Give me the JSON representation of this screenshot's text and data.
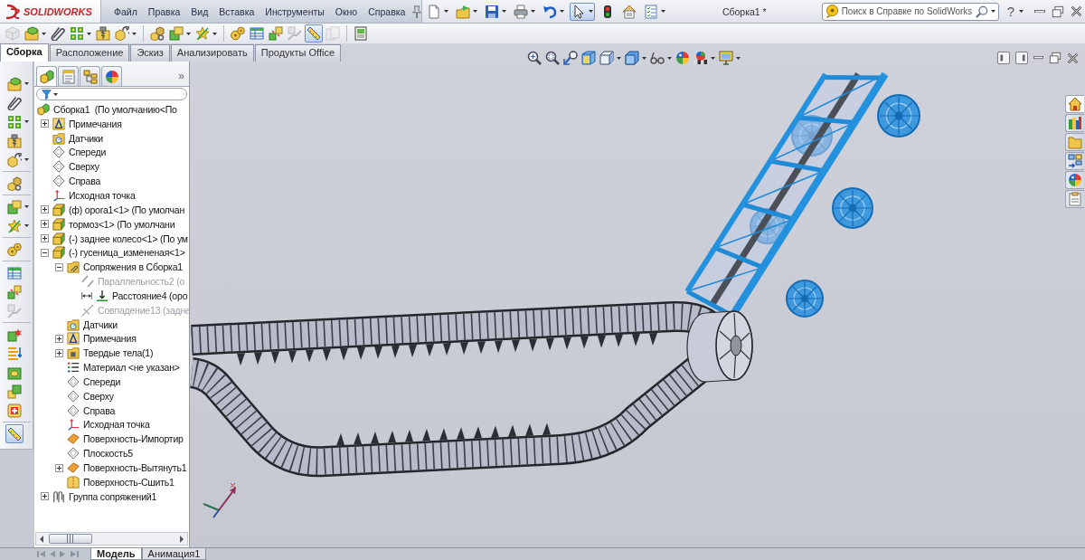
{
  "title_bar": {
    "logo": "SOLIDWORKS",
    "menu": [
      "Файл",
      "Правка",
      "Вид",
      "Вставка",
      "Инструменты",
      "Окно",
      "Справка"
    ],
    "quick_tools": [
      {
        "kind": "document",
        "dropdown": true,
        "selected": false
      },
      {
        "kind": "folder_arrow",
        "dropdown": true,
        "selected": false
      },
      {
        "kind": "floppy",
        "dropdown": true,
        "selected": false
      },
      {
        "kind": "printer",
        "dropdown": true,
        "selected": false
      },
      {
        "kind": "curved_arrow",
        "dropdown": true,
        "selected": false
      },
      {
        "kind": "cursor",
        "dropdown": true,
        "selected": true
      },
      {
        "kind": "traffic_light",
        "dropdown": false,
        "selected": false
      },
      {
        "kind": "house_page",
        "dropdown": false,
        "selected": false
      },
      {
        "kind": "checklist",
        "dropdown": true,
        "selected": false
      }
    ],
    "document_title": "Сборка1 *",
    "search": {
      "placeholder": "Поиск в Справке по SolidWorks"
    },
    "help": "?"
  },
  "command_toolbar": [
    {
      "kind": "cube",
      "dropdown": false,
      "disabled": true,
      "selected": false
    },
    {
      "kind": "folder_cube",
      "dropdown": true,
      "disabled": false,
      "selected": false
    },
    {
      "kind": "paperclip",
      "dropdown": false,
      "disabled": false,
      "selected": false
    },
    {
      "kind": "dot_grid",
      "dropdown": true,
      "disabled": false,
      "selected": false
    },
    {
      "kind": "screw",
      "dropdown": false,
      "disabled": false,
      "selected": false
    },
    {
      "kind": "cube_arrow",
      "dropdown": true,
      "disabled": false,
      "selected": false
    },
    {
      "kind": "separator"
    },
    {
      "kind": "cubes",
      "dropdown": false,
      "disabled": false,
      "selected": false
    },
    {
      "kind": "block",
      "dropdown": true,
      "disabled": false,
      "selected": false
    },
    {
      "kind": "axis_star",
      "dropdown": true,
      "disabled": false,
      "selected": false
    },
    {
      "kind": "separator"
    },
    {
      "kind": "gears",
      "dropdown": false,
      "disabled": false,
      "selected": false
    },
    {
      "kind": "table",
      "dropdown": false,
      "disabled": false,
      "selected": false
    },
    {
      "kind": "explode",
      "dropdown": false,
      "disabled": false,
      "selected": false
    },
    {
      "kind": "line_sketch",
      "dropdown": false,
      "disabled": true,
      "selected": false
    },
    {
      "kind": "ruler",
      "dropdown": false,
      "disabled": false,
      "selected": true
    },
    {
      "kind": "pages",
      "dropdown": false,
      "disabled": true,
      "selected": false
    },
    {
      "kind": "separator"
    },
    {
      "kind": "sheet",
      "dropdown": false,
      "disabled": false,
      "selected": false
    }
  ],
  "command_tabs": [
    {
      "label": "Сборка",
      "selected": true
    },
    {
      "label": "Расположение",
      "selected": false
    },
    {
      "label": "Эскиз",
      "selected": false
    },
    {
      "label": "Анализировать",
      "selected": false
    },
    {
      "label": "Продукты Office",
      "selected": false
    }
  ],
  "left_toolbar": [
    {
      "kind": "folder_cube",
      "dropdown": true,
      "disabled": false,
      "selected": false
    },
    {
      "kind": "paperclip",
      "dropdown": false,
      "disabled": false,
      "selected": false
    },
    {
      "kind": "dot_grid",
      "dropdown": true,
      "disabled": false,
      "selected": false
    },
    {
      "kind": "screw",
      "dropdown": false,
      "disabled": false,
      "selected": false
    },
    {
      "kind": "cube_arrow",
      "dropdown": true,
      "disabled": false,
      "selected": false
    },
    {
      "kind": "separator"
    },
    {
      "kind": "cubes",
      "dropdown": false,
      "disabled": false,
      "selected": false
    },
    {
      "kind": "separator"
    },
    {
      "kind": "block",
      "dropdown": true,
      "disabled": false,
      "selected": false
    },
    {
      "kind": "axis_star",
      "dropdown": true,
      "disabled": false,
      "selected": false
    },
    {
      "kind": "separator"
    },
    {
      "kind": "gears",
      "dropdown": false,
      "disabled": false,
      "selected": false
    },
    {
      "kind": "separator"
    },
    {
      "kind": "table",
      "dropdown": false,
      "disabled": false,
      "selected": false
    },
    {
      "kind": "explode",
      "dropdown": false,
      "disabled": false,
      "selected": false
    },
    {
      "kind": "line_sketch",
      "dropdown": false,
      "disabled": true,
      "selected": false
    },
    {
      "kind": "separator"
    },
    {
      "kind": "collision",
      "dropdown": false,
      "disabled": false,
      "selected": false
    },
    {
      "kind": "align",
      "dropdown": false,
      "disabled": false,
      "selected": false
    },
    {
      "kind": "hole",
      "dropdown": false,
      "disabled": false,
      "selected": false
    },
    {
      "kind": "blocks",
      "dropdown": false,
      "disabled": false,
      "selected": false
    },
    {
      "kind": "plus_box",
      "dropdown": false,
      "disabled": false,
      "selected": false
    },
    {
      "kind": "separator"
    },
    {
      "kind": "ruler",
      "dropdown": false,
      "disabled": false,
      "selected": true
    }
  ],
  "feature_manager": {
    "tabs": [
      {
        "kind": "assembly",
        "selected": true
      },
      {
        "kind": "property_sheet",
        "selected": false
      },
      {
        "kind": "tree_diagram",
        "selected": false
      },
      {
        "kind": "color_wheel",
        "selected": false
      }
    ],
    "more": "»",
    "tree": [
      {
        "label": "Сборка1  (По умолчанию<По",
        "kind": "assembly",
        "children": [
          {
            "label": "Примечания",
            "kind": "annotations",
            "expanded": false
          },
          {
            "label": "Датчики",
            "kind": "sensors"
          },
          {
            "label": "Спереди",
            "kind": "plane"
          },
          {
            "label": "Сверху",
            "kind": "plane"
          },
          {
            "label": "Справа",
            "kind": "plane"
          },
          {
            "label": "Исходная точка",
            "kind": "origin"
          },
          {
            "label": "(ф) opora1<1> (По умолчан",
            "kind": "part",
            "expanded": false
          },
          {
            "label": "тормоз<1> (По умолчани",
            "kind": "part",
            "expanded": false
          },
          {
            "label": "(-) заднее колесо<1> (По ум",
            "kind": "part",
            "expanded": false
          },
          {
            "label": "(-) гусеница_измененая<1>",
            "kind": "part",
            "expanded": true,
            "children": [
              {
                "label": "Сопряжения в Сборка1",
                "kind": "mates_folder",
                "expanded": true,
                "children": [
                  {
                    "label": "Параллельность2 (о",
                    "kind": "mate_parallel",
                    "suppressed": true
                  },
                  {
                    "label": "Расстояние4 (оро",
                    "kind": "mate_distance",
                    "suppressed": false
                  },
                  {
                    "label": "Совпадение13 (задне",
                    "kind": "mate_coincident",
                    "suppressed": true
                  }
                ]
              },
              {
                "label": "Датчики",
                "kind": "sensors"
              },
              {
                "label": "Примечания",
                "kind": "annotations",
                "expanded": false
              },
              {
                "label": "Твердые тела(1)",
                "kind": "bodies",
                "expanded": false
              },
              {
                "label": "Материал <не указан>",
                "kind": "material"
              },
              {
                "label": "Спереди",
                "kind": "plane"
              },
              {
                "label": "Сверху",
                "kind": "plane"
              },
              {
                "label": "Справа",
                "kind": "plane"
              },
              {
                "label": "Исходная точка",
                "kind": "origin"
              },
              {
                "label": "Поверхность-Импортир",
                "kind": "surface"
              },
              {
                "label": "Плоскость5",
                "kind": "plane"
              },
              {
                "label": "Поверхность-Вытянуть1",
                "kind": "surface",
                "expanded": false
              },
              {
                "label": "Поверхность-Сшить1",
                "kind": "stitch"
              }
            ]
          },
          {
            "label": "Группа сопряжений1",
            "kind": "mate_group",
            "expanded": false
          }
        ]
      }
    ]
  },
  "viewport": {
    "view_tools": [
      {
        "kind": "magnifier",
        "dropdown": false
      },
      {
        "kind": "magnifier_box",
        "dropdown": false
      },
      {
        "kind": "magnifier_arrow",
        "dropdown": false
      },
      {
        "kind": "cut_box",
        "dropdown": false
      },
      {
        "kind": "view_cube",
        "dropdown": true
      },
      {
        "kind": "shaded_cube",
        "dropdown": true
      },
      {
        "kind": "glasses",
        "dropdown": true
      },
      {
        "kind": "color_ball",
        "dropdown": false
      },
      {
        "kind": "scene_ball",
        "dropdown": true
      },
      {
        "kind": "monitor",
        "dropdown": true
      }
    ],
    "task_pane": [
      {
        "kind": "house",
        "selected": true
      },
      {
        "kind": "books",
        "selected": false
      },
      {
        "kind": "folder",
        "selected": false
      },
      {
        "kind": "arrow_grid",
        "selected": false
      },
      {
        "kind": "color_ball",
        "selected": false
      },
      {
        "kind": "clipboard",
        "selected": false
      }
    ]
  },
  "bottom_tabs": [
    {
      "label": "Модель",
      "selected": true
    },
    {
      "label": "Анимация1",
      "selected": false
    }
  ]
}
